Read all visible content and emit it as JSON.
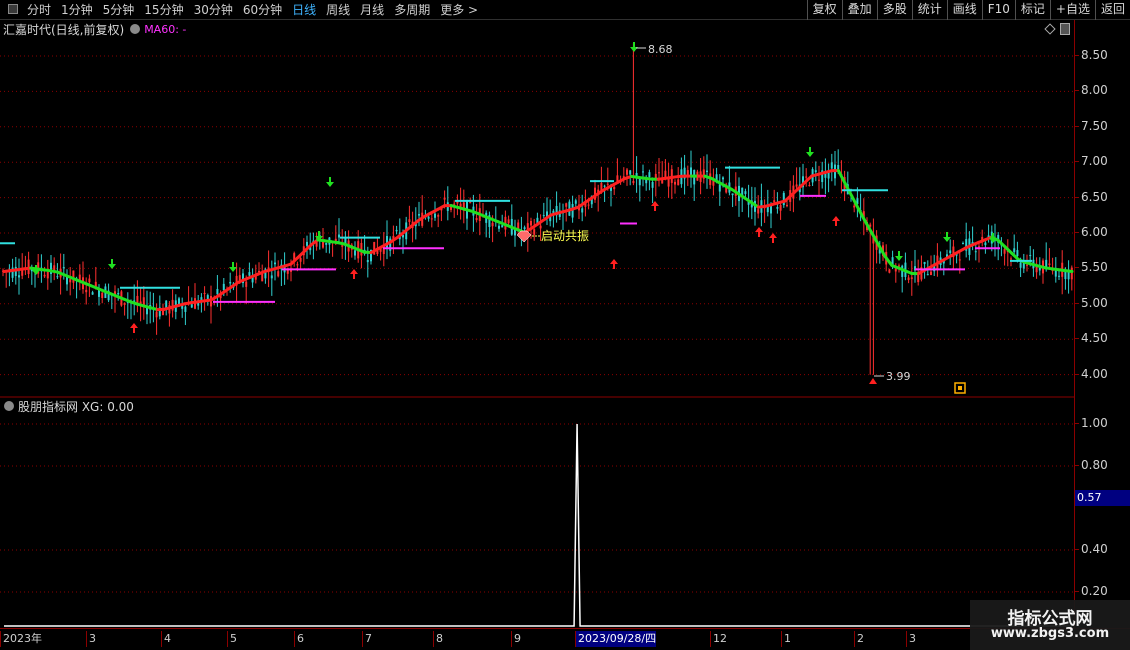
{
  "toolbar": {
    "period_tabs": [
      "分时",
      "1分钟",
      "5分钟",
      "15分钟",
      "30分钟",
      "60分钟",
      "日线",
      "周线",
      "月线",
      "多周期",
      "更多 >"
    ],
    "active_tab": "日线",
    "right_buttons": [
      "复权",
      "叠加",
      "多股",
      "统计",
      "画线",
      "F10",
      "标记",
      "+自选",
      "返回"
    ]
  },
  "main_chart": {
    "title": "汇嘉时代(日线,前复权)",
    "ma_label": "MA60: -",
    "y_ticks": [
      "8.50",
      "8.00",
      "7.50",
      "7.00",
      "6.50",
      "6.00",
      "5.50",
      "5.00",
      "4.50",
      "4.00"
    ],
    "high_label": "8.68",
    "low_label": "3.99",
    "signal_label": "启动共振"
  },
  "indicator": {
    "title": "股朋指标网 XG: 0.00",
    "y_ticks": [
      "1.00",
      "0.80",
      "0.40",
      "0.20"
    ],
    "current_value": "0.57"
  },
  "x_axis": {
    "labels": [
      "2023年",
      "3",
      "4",
      "5",
      "6",
      "7",
      "8",
      "9",
      "2023/09/28/四",
      "12",
      "1",
      "2",
      "3"
    ],
    "selected": "2023/09/28/四"
  },
  "watermark": {
    "line1": "指标公式网",
    "line2": "www.zbgs3.com"
  },
  "colors": {
    "up": "#ff3030",
    "down": "#30d0d0",
    "trend_up": "#ff2020",
    "trend_down": "#20e020",
    "level_cyan": "#30e0e0",
    "level_magenta": "#ff30ff",
    "grid": "#8b0000"
  },
  "chart_data": {
    "type": "line",
    "series": [
      {
        "values": [
          5.45,
          5.5,
          5.45,
          5.3,
          5.15,
          5.0,
          4.9,
          5.0,
          5.05,
          5.3,
          5.45,
          5.55,
          5.9,
          5.85,
          5.7,
          5.9,
          6.2,
          6.4,
          6.3,
          6.15,
          6.0,
          6.25,
          6.35,
          6.6,
          6.8,
          6.75,
          6.8,
          6.8,
          6.6,
          6.35,
          6.45,
          6.8,
          6.9,
          6.2,
          5.55,
          5.4,
          5.6,
          5.8,
          5.95,
          5.6,
          5.5,
          5.45
        ]
      }
    ],
    "ylim": [
      3.9,
      8.8
    ],
    "indicator_values": [
      0,
      0,
      0,
      0,
      0,
      0,
      0,
      0,
      0,
      0,
      0,
      0,
      0,
      0,
      0,
      0,
      0,
      0,
      0,
      0,
      0,
      0,
      1,
      0,
      0,
      0,
      0,
      0,
      0,
      0,
      0,
      0,
      0,
      0,
      0,
      0,
      0,
      0,
      0,
      0,
      0,
      0
    ]
  }
}
